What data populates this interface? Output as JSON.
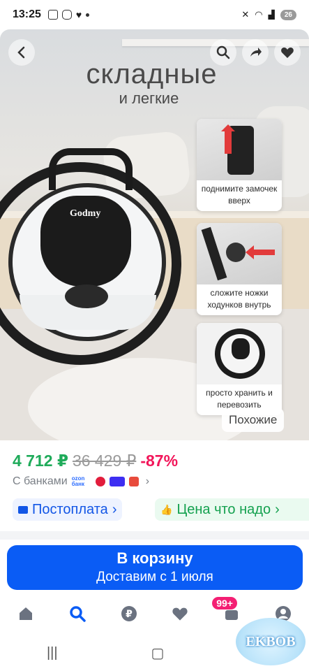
{
  "status_bar": {
    "time": "13:25",
    "battery": "26"
  },
  "hero": {
    "headline": "складные",
    "subheadline": "и легкие",
    "brand_logo": "Godmy",
    "features": [
      {
        "text": "поднимите замочек вверх",
        "icon": "lock-latch-illustration"
      },
      {
        "text": "сложите ножки ходунков внутрь",
        "icon": "fold-legs-illustration"
      },
      {
        "text": "просто хранить и перевозить",
        "icon": "walker-topview-illustration"
      }
    ],
    "similar_label": "Похожие"
  },
  "price": {
    "current": "4 712 ₽",
    "old": "36 429 ₽",
    "discount": "-87%"
  },
  "banks": {
    "label": "С банками",
    "ozon_logo": "ozon банк",
    "colors": [
      "#e21d3c",
      "#3d2ef2",
      "#e84b3c"
    ]
  },
  "offers": {
    "postpay": "Постоплата",
    "price_you_want": "Цена что надо"
  },
  "cart": {
    "button_label": "В корзину",
    "delivery": "Доставим с 1 июля"
  },
  "bottom_nav": {
    "items": [
      "home-icon",
      "search-icon",
      "ruble-icon",
      "heart-icon",
      "cart-icon",
      "profile-icon"
    ],
    "cart_badge": "99+"
  },
  "watermark": "EKBOB",
  "colors": {
    "accent_blue": "#0a5cf5",
    "price_green": "#1fab5a",
    "discount_pink": "#f2165a",
    "badge_pink": "#f41f73"
  }
}
